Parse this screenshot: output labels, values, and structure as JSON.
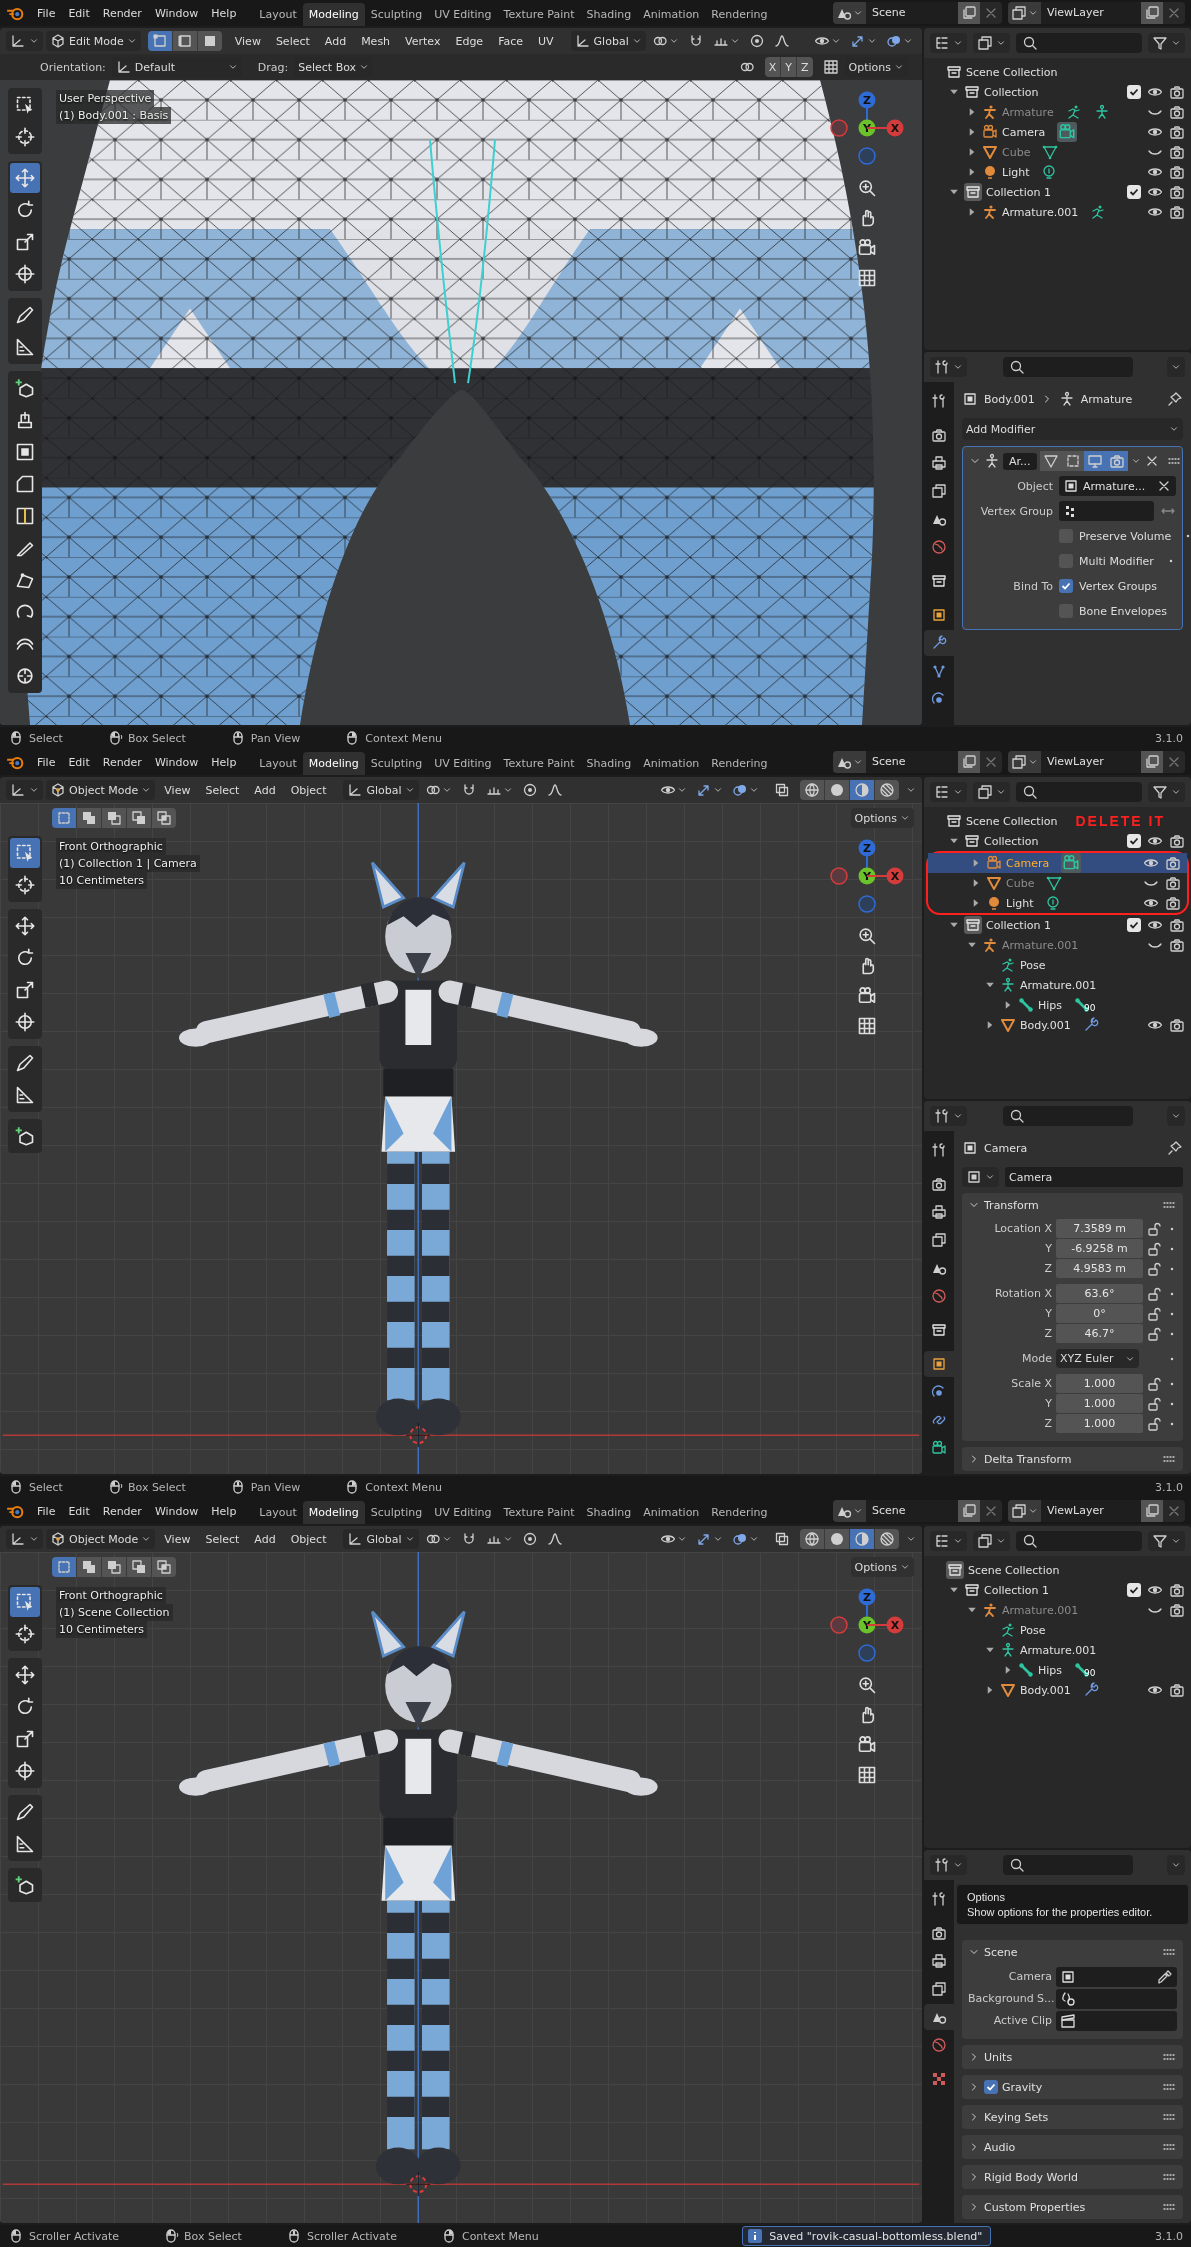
{
  "screens": [
    {
      "topbar": {
        "menus": [
          "File",
          "Edit",
          "Render",
          "Window",
          "Help"
        ],
        "workspaces": [
          {
            "label": "Layout",
            "selected": false
          },
          {
            "label": "Modeling",
            "selected": true
          },
          {
            "label": "Sculpting",
            "selected": false
          },
          {
            "label": "UV Editing",
            "selected": false
          },
          {
            "label": "Texture Paint",
            "selected": false
          },
          {
            "label": "Shading",
            "selected": false
          },
          {
            "label": "Animation",
            "selected": false
          },
          {
            "label": "Rendering",
            "selected": false
          }
        ],
        "scene": "Scene",
        "view_layer": "ViewLayer"
      },
      "viewport": {
        "mode": "Edit Mode",
        "kind": "edit",
        "element_modes": [
          {
            "kind": "vertex",
            "selected": true
          },
          {
            "kind": "edge",
            "selected": false
          },
          {
            "kind": "face",
            "selected": false
          }
        ],
        "menus": [
          "View",
          "Select",
          "Add",
          "Mesh",
          "Vertex",
          "Edge",
          "Face",
          "UV"
        ],
        "orientation": "Global",
        "tool_settings": {
          "orientation_label": "Orientation:",
          "orientation": "Default",
          "drag_label": "Drag:",
          "drag": "Select Box",
          "axes": [
            "X",
            "Y",
            "Z"
          ],
          "options": "Options"
        },
        "overlay_text": [
          "User Perspective",
          "(1) Body.001 : Basis"
        ],
        "gizmo": [
          "Z",
          "Y",
          "X"
        ],
        "tool_groups": [
          {
            "tools": [
              {
                "kind": "select",
                "selected": false
              },
              {
                "kind": "cursor",
                "selected": false
              }
            ]
          },
          {
            "tools": [
              {
                "kind": "move",
                "selected": true
              },
              {
                "kind": "rotate",
                "selected": false
              },
              {
                "kind": "scale",
                "selected": false
              },
              {
                "kind": "transform",
                "selected": false
              }
            ]
          },
          {
            "tools": [
              {
                "kind": "annotate",
                "selected": false
              },
              {
                "kind": "measure",
                "selected": false
              }
            ]
          },
          {
            "tools": [
              {
                "kind": "add-cube",
                "selected": false
              },
              {
                "kind": "extrude",
                "selected": false
              },
              {
                "kind": "inset",
                "selected": false
              },
              {
                "kind": "bevel",
                "selected": false
              },
              {
                "kind": "loop-cut",
                "selected": false
              },
              {
                "kind": "knife",
                "selected": false
              },
              {
                "kind": "poly-build",
                "selected": false
              },
              {
                "kind": "spin",
                "selected": false
              },
              {
                "kind": "smooth",
                "selected": false
              },
              {
                "kind": "shrink",
                "selected": false
              }
            ]
          }
        ]
      },
      "outliner": {
        "items": [
          {
            "name": "Scene Collection",
            "kind": "scene-collection",
            "selected": false,
            "active": false,
            "children": [
              {
                "name": "Collection",
                "kind": "collection",
                "selected": false,
                "active": false,
                "expanded": true,
                "checked": true,
                "hidden": false,
                "children": [
                  {
                    "name": "Armature",
                    "kind": "armature",
                    "selected": false,
                    "expanded": false,
                    "hidden": true,
                    "data_icons": [
                      {
                        "kind": "pose"
                      },
                      {
                        "kind": "armature-data"
                      }
                    ]
                  },
                  {
                    "name": "Camera",
                    "kind": "camera",
                    "selected": false,
                    "expanded": false,
                    "hidden": false,
                    "data_icons": [
                      {
                        "kind": "camera-data",
                        "active": true
                      }
                    ]
                  },
                  {
                    "name": "Cube",
                    "kind": "mesh",
                    "selected": false,
                    "expanded": false,
                    "hidden": true,
                    "data_icons": [
                      {
                        "kind": "mesh-data"
                      }
                    ]
                  },
                  {
                    "name": "Light",
                    "kind": "light",
                    "selected": false,
                    "expanded": false,
                    "hidden": false,
                    "data_icons": [
                      {
                        "kind": "light-data"
                      }
                    ]
                  }
                ]
              },
              {
                "name": "Collection 1",
                "kind": "collection",
                "selected": false,
                "active": true,
                "expanded": true,
                "checked": true,
                "hidden": false,
                "children": [
                  {
                    "name": "Armature.001",
                    "kind": "armature",
                    "selected": false,
                    "expanded": false,
                    "hidden": false,
                    "data_icons": [
                      {
                        "kind": "pose"
                      }
                    ]
                  }
                ]
              }
            ]
          }
        ]
      },
      "properties": {
        "kind": "modifiers",
        "tab_groups": [
          {
            "tabs": [
              {
                "kind": "tool",
                "selected": false
              }
            ]
          },
          {
            "tabs": [
              {
                "kind": "render",
                "selected": false
              },
              {
                "kind": "output",
                "selected": false
              },
              {
                "kind": "view-layer",
                "selected": false
              },
              {
                "kind": "scene",
                "selected": false
              },
              {
                "kind": "world",
                "selected": false
              }
            ]
          },
          {
            "tabs": [
              {
                "kind": "collection",
                "selected": false
              }
            ]
          },
          {
            "tabs": [
              {
                "kind": "object",
                "selected": false
              },
              {
                "kind": "modifier",
                "selected": true
              },
              {
                "kind": "particles",
                "selected": false
              },
              {
                "kind": "physics",
                "selected": false
              }
            ]
          }
        ],
        "breadcrumb": [
          "Body.001",
          "Armature"
        ],
        "add_modifier": "Add Modifier",
        "modifier": {
          "name": "Ar...",
          "expanded": true,
          "toggles": [
            {
              "kind": "edit-cage",
              "on": false
            },
            {
              "kind": "edit-mode",
              "on": false
            },
            {
              "kind": "viewport",
              "on": true
            },
            {
              "kind": "render",
              "on": true
            }
          ],
          "fields": [
            {
              "label": "Object",
              "value": "Armature..."
            },
            {
              "label": "Vertex Group"
            }
          ],
          "options": [
            {
              "label": "Preserve Volume",
              "checked": false
            },
            {
              "label": "Multi Modifier",
              "checked": false
            }
          ],
          "bind_label": "Bind To",
          "bind": [
            {
              "label": "Vertex Groups",
              "checked": true
            },
            {
              "label": "Bone Envelopes",
              "checked": false
            }
          ]
        }
      },
      "status_bar": {
        "items": [
          {
            "kind": "left",
            "label": "Select"
          },
          {
            "kind": "drag",
            "label": "Box Select"
          },
          {
            "kind": "middle",
            "label": "Pan View"
          },
          {
            "kind": "right",
            "label": "Context Menu"
          }
        ],
        "version": "3.1.0"
      }
    },
    {
      "topbar": {
        "menus": [
          "File",
          "Edit",
          "Render",
          "Window",
          "Help"
        ],
        "workspaces": [
          {
            "label": "Layout",
            "selected": false
          },
          {
            "label": "Modeling",
            "selected": true
          },
          {
            "label": "Sculpting",
            "selected": false
          },
          {
            "label": "UV Editing",
            "selected": false
          },
          {
            "label": "Texture Paint",
            "selected": false
          },
          {
            "label": "Shading",
            "selected": false
          },
          {
            "label": "Animation",
            "selected": false
          },
          {
            "label": "Rendering",
            "selected": false
          }
        ],
        "scene": "Scene",
        "view_layer": "ViewLayer"
      },
      "viewport": {
        "mode": "Object Mode",
        "kind": "object",
        "menus": [
          "View",
          "Select",
          "Add",
          "Object"
        ],
        "orientation": "Global",
        "shading": [
          {
            "kind": "wireframe",
            "selected": false
          },
          {
            "kind": "solid",
            "selected": false
          },
          {
            "kind": "material",
            "selected": true
          },
          {
            "kind": "rendered",
            "selected": false
          }
        ],
        "select_modes": [
          {
            "kind": "set",
            "selected": true
          },
          {
            "kind": "extend",
            "selected": false
          },
          {
            "kind": "subtract",
            "selected": false
          },
          {
            "kind": "invert",
            "selected": false
          },
          {
            "kind": "intersect",
            "selected": false
          }
        ],
        "options": "Options",
        "overlay_text": [
          "Front Orthographic",
          "(1) Collection 1 | Camera",
          "10 Centimeters"
        ],
        "gizmo": [
          "Z",
          "Y",
          "X"
        ],
        "tool_groups": [
          {
            "tools": [
              {
                "kind": "select",
                "selected": true
              },
              {
                "kind": "cursor",
                "selected": false
              }
            ]
          },
          {
            "tools": [
              {
                "kind": "move",
                "selected": false
              },
              {
                "kind": "rotate",
                "selected": false
              },
              {
                "kind": "scale",
                "selected": false
              },
              {
                "kind": "transform",
                "selected": false
              }
            ]
          },
          {
            "tools": [
              {
                "kind": "annotate",
                "selected": false
              },
              {
                "kind": "measure",
                "selected": false
              }
            ]
          },
          {
            "tools": [
              {
                "kind": "add-cube",
                "selected": false
              }
            ]
          }
        ]
      },
      "outliner": {
        "items": [
          {
            "name": "Scene Collection",
            "kind": "scene-collection",
            "selected": false,
            "active": false,
            "annotation": "DELETE IT",
            "children": [
              {
                "name": "Collection",
                "kind": "collection",
                "selected": false,
                "active": false,
                "expanded": true,
                "checked": true,
                "hidden": false,
                "circled": true,
                "children": [
                  {
                    "name": "Camera",
                    "kind": "camera",
                    "selected": true,
                    "expanded": false,
                    "hidden": false,
                    "data_icons": [
                      {
                        "kind": "camera-data",
                        "active": true
                      }
                    ]
                  },
                  {
                    "name": "Cube",
                    "kind": "mesh",
                    "selected": false,
                    "expanded": false,
                    "hidden": true,
                    "data_icons": [
                      {
                        "kind": "mesh-data"
                      }
                    ]
                  },
                  {
                    "name": "Light",
                    "kind": "light",
                    "selected": false,
                    "expanded": false,
                    "hidden": false,
                    "data_icons": [
                      {
                        "kind": "light-data"
                      }
                    ]
                  }
                ]
              },
              {
                "name": "Collection 1",
                "kind": "collection",
                "selected": false,
                "active": true,
                "expanded": true,
                "checked": true,
                "hidden": false,
                "children": [
                  {
                    "name": "Armature.001",
                    "kind": "armature",
                    "selected": false,
                    "expanded": true,
                    "hidden": true,
                    "children": [
                      {
                        "name": "Pose",
                        "kind": "pose",
                        "selected": false
                      },
                      {
                        "name": "Armature.001",
                        "kind": "armature-data",
                        "selected": false,
                        "expanded": true,
                        "children": [
                          {
                            "name": "Hips",
                            "kind": "bone",
                            "selected": false,
                            "expanded": false,
                            "data_icons": [
                              {
                                "kind": "bone",
                                "badge": "90"
                              }
                            ]
                          }
                        ]
                      },
                      {
                        "name": "Body.001",
                        "kind": "mesh",
                        "selected": false,
                        "expanded": false,
                        "hidden": false,
                        "data_icons": [
                          {
                            "kind": "modifier"
                          }
                        ]
                      }
                    ]
                  }
                ]
              }
            ]
          }
        ]
      },
      "properties": {
        "kind": "object",
        "tab_groups": [
          {
            "tabs": [
              {
                "kind": "tool",
                "selected": false
              }
            ]
          },
          {
            "tabs": [
              {
                "kind": "render",
                "selected": false
              },
              {
                "kind": "output",
                "selected": false
              },
              {
                "kind": "view-layer",
                "selected": false
              },
              {
                "kind": "scene",
                "selected": false
              },
              {
                "kind": "world",
                "selected": false
              }
            ]
          },
          {
            "tabs": [
              {
                "kind": "collection",
                "selected": false
              }
            ]
          },
          {
            "tabs": [
              {
                "kind": "object",
                "selected": true
              },
              {
                "kind": "physics",
                "selected": false
              },
              {
                "kind": "constraints",
                "selected": false
              },
              {
                "kind": "camera-data",
                "selected": false
              }
            ]
          }
        ],
        "title": "Camera",
        "datablock": "Camera",
        "panels": [
          {
            "title": "Transform",
            "expanded": true,
            "groups": [
              {
                "rows": [
                  {
                    "label": "Location X",
                    "value": "7.3589 m",
                    "kind": "number"
                  },
                  {
                    "label": "Y",
                    "value": "-6.9258 m",
                    "kind": "number"
                  },
                  {
                    "label": "Z",
                    "value": "4.9583 m",
                    "kind": "number"
                  }
                ]
              },
              {
                "rows": [
                  {
                    "label": "Rotation X",
                    "value": "63.6°",
                    "kind": "number"
                  },
                  {
                    "label": "Y",
                    "value": "0°",
                    "kind": "number"
                  },
                  {
                    "label": "Z",
                    "value": "46.7°",
                    "kind": "number"
                  }
                ]
              },
              {
                "rows": [
                  {
                    "label": "Mode",
                    "value": "XYZ Euler",
                    "kind": "dropdown"
                  }
                ]
              },
              {
                "rows": [
                  {
                    "label": "Scale X",
                    "value": "1.000",
                    "kind": "number"
                  },
                  {
                    "label": "Y",
                    "value": "1.000",
                    "kind": "number"
                  },
                  {
                    "label": "Z",
                    "value": "1.000",
                    "kind": "number"
                  }
                ]
              }
            ]
          },
          {
            "title": "Delta Transform",
            "expanded": false
          }
        ]
      },
      "status_bar": {
        "items": [
          {
            "kind": "left",
            "label": "Select"
          },
          {
            "kind": "drag",
            "label": "Box Select"
          },
          {
            "kind": "middle",
            "label": "Pan View"
          },
          {
            "kind": "right",
            "label": "Context Menu"
          }
        ],
        "version": "3.1.0"
      }
    },
    {
      "topbar": {
        "menus": [
          "File",
          "Edit",
          "Render",
          "Window",
          "Help"
        ],
        "workspaces": [
          {
            "label": "Layout",
            "selected": false
          },
          {
            "label": "Modeling",
            "selected": true
          },
          {
            "label": "Sculpting",
            "selected": false
          },
          {
            "label": "UV Editing",
            "selected": false
          },
          {
            "label": "Texture Paint",
            "selected": false
          },
          {
            "label": "Shading",
            "selected": false
          },
          {
            "label": "Animation",
            "selected": false
          },
          {
            "label": "Rendering",
            "selected": false
          }
        ],
        "scene": "Scene",
        "view_layer": "ViewLayer"
      },
      "viewport": {
        "mode": "Object Mode",
        "kind": "object",
        "menus": [
          "View",
          "Select",
          "Add",
          "Object"
        ],
        "orientation": "Global",
        "shading": [
          {
            "kind": "wireframe",
            "selected": false
          },
          {
            "kind": "solid",
            "selected": false
          },
          {
            "kind": "material",
            "selected": true
          },
          {
            "kind": "rendered",
            "selected": false
          }
        ],
        "select_modes": [
          {
            "kind": "set",
            "selected": true
          },
          {
            "kind": "extend",
            "selected": false
          },
          {
            "kind": "subtract",
            "selected": false
          },
          {
            "kind": "invert",
            "selected": false
          },
          {
            "kind": "intersect",
            "selected": false
          }
        ],
        "options": "Options",
        "overlay_text": [
          "Front Orthographic",
          "(1) Scene Collection",
          "10 Centimeters"
        ],
        "gizmo": [
          "Z",
          "Y",
          "X"
        ],
        "tool_groups": [
          {
            "tools": [
              {
                "kind": "select",
                "selected": true
              },
              {
                "kind": "cursor",
                "selected": false
              }
            ]
          },
          {
            "tools": [
              {
                "kind": "move",
                "selected": false
              },
              {
                "kind": "rotate",
                "selected": false
              },
              {
                "kind": "scale",
                "selected": false
              },
              {
                "kind": "transform",
                "selected": false
              }
            ]
          },
          {
            "tools": [
              {
                "kind": "annotate",
                "selected": false
              },
              {
                "kind": "measure",
                "selected": false
              }
            ]
          },
          {
            "tools": [
              {
                "kind": "add-cube",
                "selected": false
              }
            ]
          }
        ]
      },
      "outliner": {
        "items": [
          {
            "name": "Scene Collection",
            "kind": "scene-collection",
            "selected": false,
            "active": true,
            "children": [
              {
                "name": "Collection 1",
                "kind": "collection",
                "selected": false,
                "active": false,
                "expanded": true,
                "checked": true,
                "hidden": false,
                "children": [
                  {
                    "name": "Armature.001",
                    "kind": "armature",
                    "selected": false,
                    "expanded": true,
                    "hidden": true,
                    "children": [
                      {
                        "name": "Pose",
                        "kind": "pose",
                        "selected": false
                      },
                      {
                        "name": "Armature.001",
                        "kind": "armature-data",
                        "selected": false,
                        "expanded": true,
                        "children": [
                          {
                            "name": "Hips",
                            "kind": "bone",
                            "selected": false,
                            "expanded": false,
                            "data_icons": [
                              {
                                "kind": "bone",
                                "badge": "90"
                              }
                            ]
                          }
                        ]
                      },
                      {
                        "name": "Body.001",
                        "kind": "mesh",
                        "selected": false,
                        "expanded": false,
                        "hidden": false,
                        "data_icons": [
                          {
                            "kind": "modifier"
                          }
                        ]
                      }
                    ]
                  }
                ]
              }
            ]
          }
        ]
      },
      "properties": {
        "kind": "scene",
        "tab_groups": [
          {
            "tabs": [
              {
                "kind": "tool",
                "selected": false
              }
            ]
          },
          {
            "tabs": [
              {
                "kind": "render",
                "selected": false
              },
              {
                "kind": "output",
                "selected": false
              },
              {
                "kind": "view-layer",
                "selected": false
              },
              {
                "kind": "scene",
                "selected": true
              },
              {
                "kind": "world",
                "selected": false
              }
            ]
          },
          {
            "tabs": [
              {
                "kind": "texture",
                "selected": false
              }
            ]
          }
        ],
        "tooltip": {
          "title": "Options",
          "text": "Show options for the properties editor."
        },
        "panels": [
          {
            "title": "Scene",
            "expanded": true,
            "groups": [
              {
                "rows": [
                  {
                    "label": "Camera",
                    "kind": "object-field"
                  },
                  {
                    "label": "Background S...",
                    "kind": "sound-field"
                  },
                  {
                    "label": "Active Clip",
                    "kind": "clip-field"
                  }
                ]
              }
            ]
          },
          {
            "title": "Units",
            "expanded": false
          },
          {
            "title": "Gravity",
            "expanded": false,
            "checked": true
          },
          {
            "title": "Keying Sets",
            "expanded": false
          },
          {
            "title": "Audio",
            "expanded": false
          },
          {
            "title": "Rigid Body World",
            "expanded": false
          },
          {
            "title": "Custom Properties",
            "expanded": false
          }
        ]
      },
      "status_bar": {
        "items": [
          {
            "kind": "left",
            "label": "Scroller Activate"
          },
          {
            "kind": "drag",
            "label": "Box Select"
          },
          {
            "kind": "middle",
            "label": "Scroller Activate"
          },
          {
            "kind": "right",
            "label": "Context Menu"
          }
        ],
        "message": "Saved \"rovik-casual-bottomless.blend\"",
        "version": "3.1.0"
      }
    }
  ]
}
